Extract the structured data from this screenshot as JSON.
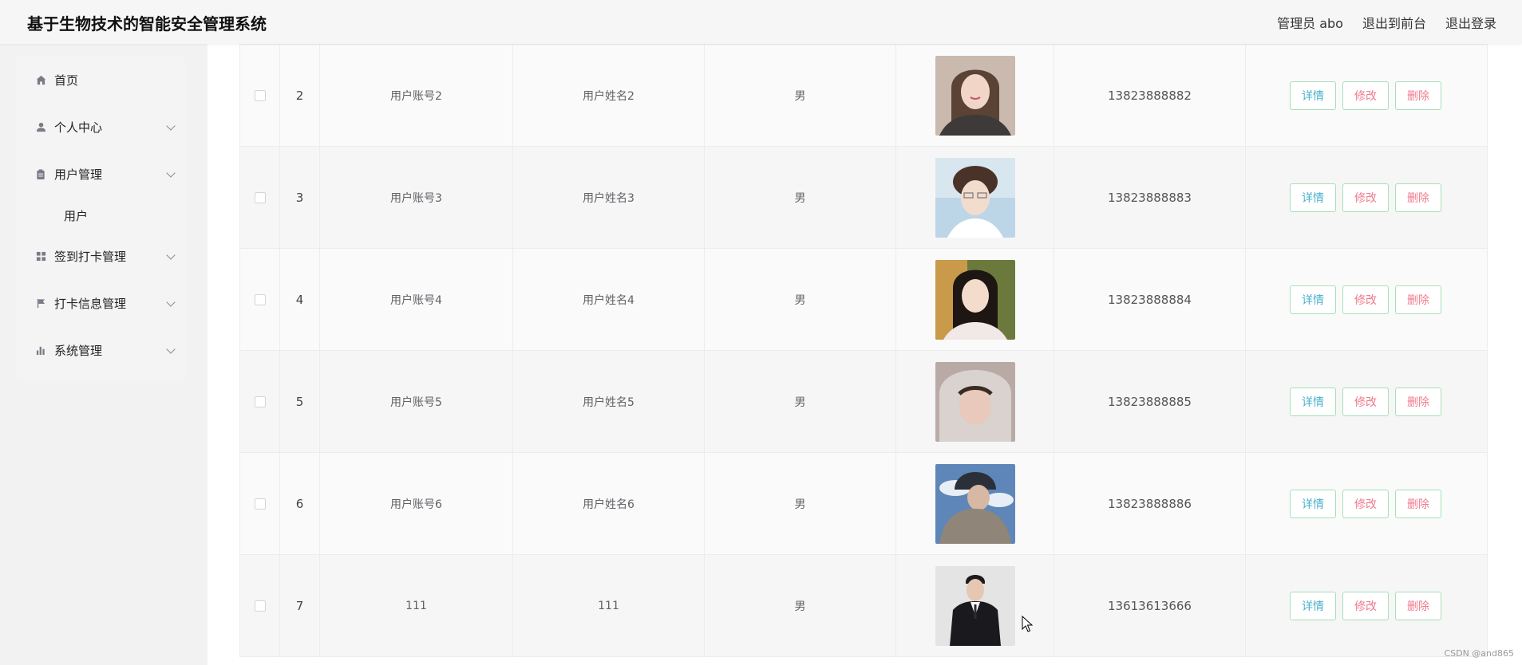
{
  "app": {
    "title": "基于生物技术的智能安全管理系统"
  },
  "header": {
    "admin": "管理员 abo",
    "front": "退出到前台",
    "logout": "退出登录"
  },
  "sidebar": {
    "items": [
      {
        "label": "首页",
        "icon": "home-icon"
      },
      {
        "label": "个人中心",
        "icon": "user-icon"
      },
      {
        "label": "用户管理",
        "icon": "clipboard-icon"
      },
      {
        "label": "用户",
        "icon": ""
      },
      {
        "label": "签到打卡管理",
        "icon": "grid-icon"
      },
      {
        "label": "打卡信息管理",
        "icon": "flag-icon"
      },
      {
        "label": "系统管理",
        "icon": "bar-chart-icon"
      }
    ]
  },
  "table": {
    "rows": [
      {
        "index": "2",
        "account": "用户账号2",
        "name": "用户姓名2",
        "sex": "男",
        "phone": "13823888882"
      },
      {
        "index": "3",
        "account": "用户账号3",
        "name": "用户姓名3",
        "sex": "男",
        "phone": "13823888883"
      },
      {
        "index": "4",
        "account": "用户账号4",
        "name": "用户姓名4",
        "sex": "男",
        "phone": "13823888884"
      },
      {
        "index": "5",
        "account": "用户账号5",
        "name": "用户姓名5",
        "sex": "男",
        "phone": "13823888885"
      },
      {
        "index": "6",
        "account": "用户账号6",
        "name": "用户姓名6",
        "sex": "男",
        "phone": "13823888886"
      },
      {
        "index": "7",
        "account": "111",
        "name": "111",
        "sex": "男",
        "phone": "13613613666"
      }
    ],
    "actions": {
      "detail": "详情",
      "edit": "修改",
      "delete": "删除"
    }
  },
  "colors": {
    "accent_green": "#a6e0b6",
    "detail_blue": "#4ab0cc",
    "danger_pink": "#f07b8e"
  },
  "watermark": "CSDN @and865"
}
